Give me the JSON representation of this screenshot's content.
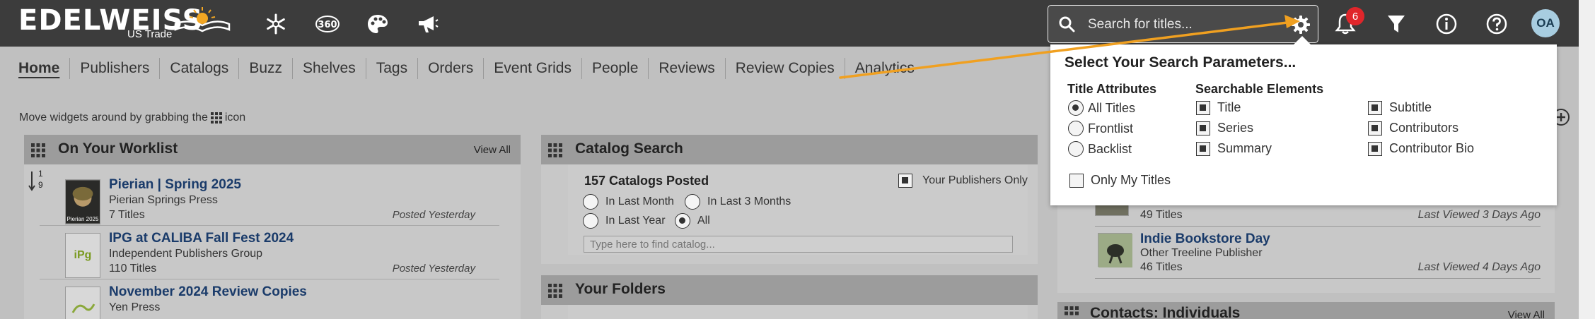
{
  "header": {
    "logo_main": "EDELWEISS",
    "logo_sub": "US Trade",
    "icons": [
      "snowflake-icon",
      "360-icon",
      "palette-icon",
      "megaphone-icon"
    ],
    "search_placeholder": "Search for titles...",
    "notification_count": "6",
    "avatar_initials": "OA"
  },
  "nav": [
    "Home",
    "Publishers",
    "Catalogs",
    "Buzz",
    "Shelves",
    "Tags",
    "Orders",
    "Event Grids",
    "People",
    "Reviews",
    "Review Copies",
    "Analytics"
  ],
  "hint": {
    "before": "Move widgets around by grabbing the",
    "after": "icon"
  },
  "worklist": {
    "title": "On Your Worklist",
    "view_all": "View All",
    "sort_label_top": "1",
    "sort_label_bottom": "9",
    "items": [
      {
        "title": "Pierian | Spring 2025",
        "publisher": "Pierian Springs Press",
        "count": "7 Titles",
        "date": "Posted Yesterday",
        "thumb_text": "Pierian 2025"
      },
      {
        "title": "IPG at CALIBA Fall Fest 2024",
        "publisher": "Independent Publishers Group",
        "count": "110 Titles",
        "date": "Posted Yesterday",
        "thumb_text": "iPg"
      },
      {
        "title": "November 2024 Review Copies",
        "publisher": "Yen Press",
        "count": "",
        "date": "",
        "thumb_text": ""
      }
    ]
  },
  "catalog_search": {
    "title": "Catalog Search",
    "count_label": "157 Catalogs Posted",
    "publishers_only": "Your Publishers Only",
    "options": [
      "In Last Month",
      "In Last 3 Months",
      "In Last Year",
      "All"
    ],
    "selected": "All",
    "find_placeholder": "Type here to find catalog..."
  },
  "folders": {
    "title": "Your Folders"
  },
  "right_list": [
    {
      "title": "",
      "subtitle": "",
      "count": "49 Titles",
      "date": "Last Viewed 3 Days Ago"
    },
    {
      "title": "Indie Bookstore Day",
      "subtitle": "Other Treeline Publisher",
      "count": "46 Titles",
      "date": "Last Viewed 4 Days Ago"
    }
  ],
  "contacts": {
    "title": "Contacts: Individuals",
    "view_all": "View All"
  },
  "search_params": {
    "title": "Select Your Search Parameters...",
    "attributes_heading": "Title Attributes",
    "elements_heading": "Searchable Elements",
    "attributes": [
      "All Titles",
      "Frontlist",
      "Backlist"
    ],
    "selected_attribute": "All Titles",
    "only_my_titles": "Only My Titles",
    "elements_col1": [
      "Title",
      "Series",
      "Summary"
    ],
    "elements_col2": [
      "Subtitle",
      "Contributors",
      "Contributor Bio"
    ]
  },
  "colors": {
    "topbar": "#3c3c3c",
    "accent_arrow": "#f0a020",
    "link": "#1a3b6a",
    "badge": "#e0262b"
  }
}
